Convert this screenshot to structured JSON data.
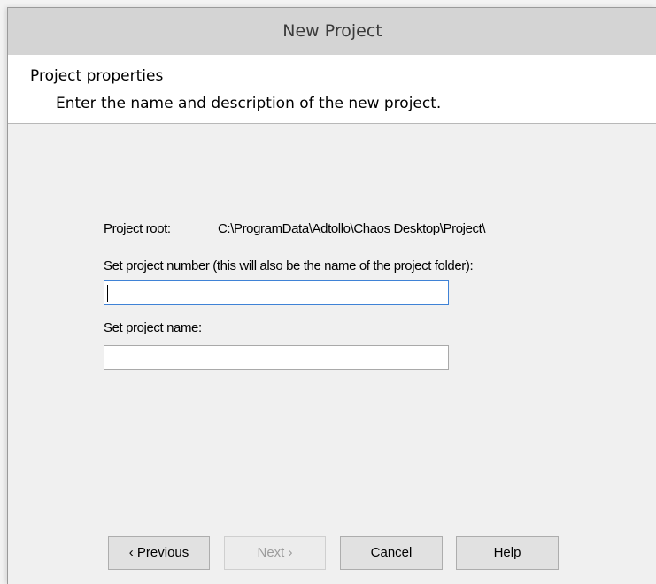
{
  "window": {
    "title": "New Project"
  },
  "header": {
    "title": "Project properties",
    "subtitle": "Enter the name and description of the new project."
  },
  "form": {
    "project_root_label": "Project root:",
    "project_root_value": "C:\\ProgramData\\Adtollo\\Chaos Desktop\\Project\\",
    "project_number_label": "Set project number (this will also be the name of the project folder):",
    "project_number_value": "",
    "project_name_label": "Set project name:",
    "project_name_value": ""
  },
  "buttons": {
    "previous": "‹ Previous",
    "next": "Next ›",
    "cancel": "Cancel",
    "help": "Help"
  },
  "colors": {
    "focus_border": "#3f82d6",
    "titlebar": "#d4d4d4"
  }
}
